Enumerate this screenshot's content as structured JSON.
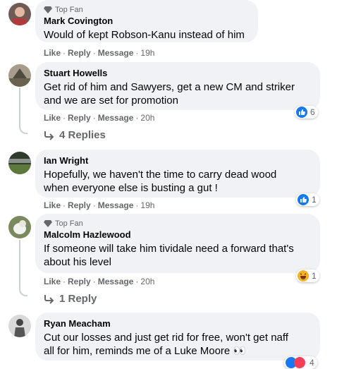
{
  "comments": [
    {
      "badge": "Top Fan",
      "author": "Mark Covington",
      "text": "Would of kept Robson-Kanu instead of him",
      "actions": {
        "like": "Like",
        "reply": "Reply",
        "message": "Message",
        "time": "19h"
      }
    },
    {
      "author": "Stuart Howells",
      "text_lines": [
        "Get rid of him and Sawyers, get a new CM and striker",
        "and we are set for promotion"
      ],
      "actions": {
        "like": "Like",
        "reply": "Reply",
        "message": "Message",
        "time": "20h"
      },
      "reaction_count": "6",
      "replies": "4 Replies"
    },
    {
      "author": "Ian Wright",
      "text_lines": [
        "Hopefully, we haven't the time to carry dead wood",
        "when everyone else is busting a gut !"
      ],
      "actions": {
        "like": "Like",
        "reply": "Reply",
        "message": "Message",
        "time": "19h"
      },
      "reaction_count": "1"
    },
    {
      "badge": "Top Fan",
      "author": "Malcolm Hazlewood",
      "text_lines": [
        "If someone will take him tividale need a forward that's",
        "about his level"
      ],
      "actions": {
        "like": "Like",
        "reply": "Reply",
        "message": "Message",
        "time": "20h"
      },
      "reaction_count": "1",
      "replies": "1 Reply"
    },
    {
      "author": "Ryan Meacham",
      "text_lines": [
        "Cut our losses and just get rid for free, won't get naff",
        "all for him, reminds me of a Luke Moore 👀"
      ],
      "reaction_count": "4"
    }
  ],
  "colors": {
    "like_blue": "#1877f2",
    "haha_yellow": "#f7b125",
    "bubble": "#f0f2f5",
    "meta": "#65676b"
  }
}
